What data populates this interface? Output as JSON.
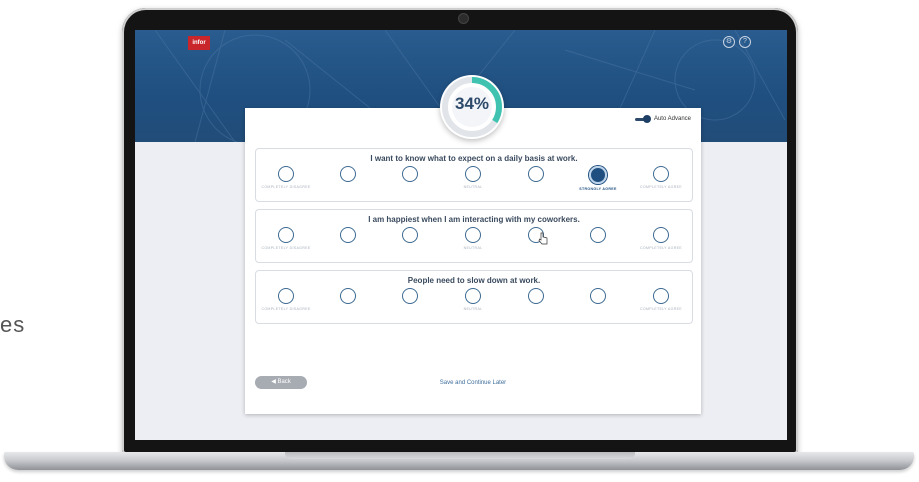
{
  "side_text": "es",
  "app": {
    "logo_text": "infor",
    "top_icons": [
      {
        "name": "settings-icon",
        "glyph": "⚙"
      },
      {
        "name": "help-icon",
        "glyph": "?"
      }
    ]
  },
  "progress": {
    "label": "34%",
    "value": 0.34,
    "accent_color": "#3fc3b0"
  },
  "auto_advance": {
    "label": "Auto Advance",
    "enabled": true
  },
  "scale_labels": {
    "left": "COMPLETELY DISAGREE",
    "middle": "NEUTRAL",
    "right": "COMPLETELY AGREE",
    "strongly_agree": "STRONGLY AGREE"
  },
  "questions": [
    {
      "text": "I want to know what to expect on a daily basis at work.",
      "selected_index": 5
    },
    {
      "text": "I am happiest when I am interacting with my coworkers.",
      "selected_index": null
    },
    {
      "text": "People need to slow down at work.",
      "selected_index": null
    }
  ],
  "footer": {
    "back_label": "◀ Back",
    "save_label": "Save and Continue Later"
  },
  "colors": {
    "banner": "#1f4f80",
    "primary": "#1f4f80"
  }
}
